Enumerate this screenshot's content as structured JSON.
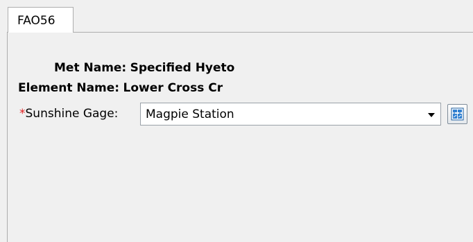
{
  "tabs": [
    {
      "label": "FAO56",
      "selected": true
    }
  ],
  "form": {
    "met_name_label": "Met Name:",
    "met_name_value": "Specified Hyeto",
    "element_name_label": "Element Name:",
    "element_name_value": "Lower Cross Cr",
    "sunshine_gage": {
      "required_marker": "*",
      "label": "Sunshine Gage:",
      "selected_value": "Magpie Station",
      "dropdown_icon": "chevron-down-icon",
      "button_icon": "gage-selector-icon"
    }
  },
  "colors": {
    "required": "#e02020",
    "background": "#f0f0f0",
    "field_border": "#9aa1a8",
    "icon_blue": "#2f7fd1"
  }
}
